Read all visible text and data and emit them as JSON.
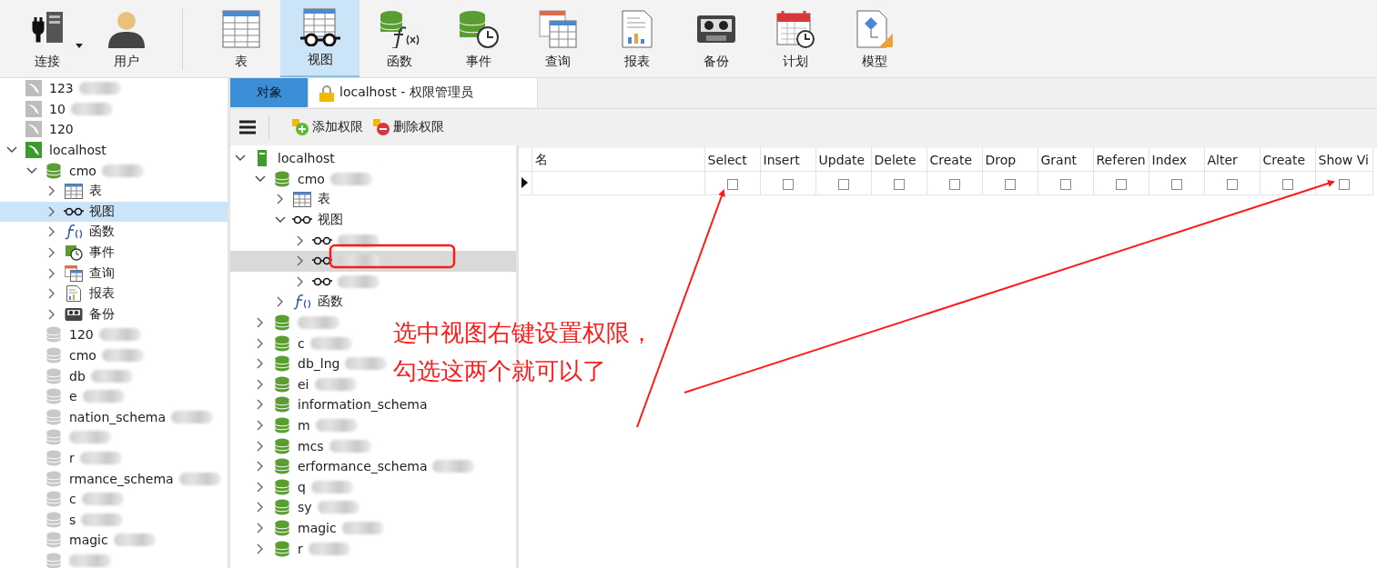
{
  "toolbar": {
    "items": [
      {
        "label": "连接",
        "kind": "connect",
        "selected": false
      },
      {
        "label": "用户",
        "kind": "user",
        "selected": false
      },
      {
        "label": "表",
        "kind": "table",
        "selected": false
      },
      {
        "label": "视图",
        "kind": "view",
        "selected": true
      },
      {
        "label": "函数",
        "kind": "function",
        "selected": false
      },
      {
        "label": "事件",
        "kind": "event",
        "selected": false
      },
      {
        "label": "查询",
        "kind": "query",
        "selected": false
      },
      {
        "label": "报表",
        "kind": "report",
        "selected": false
      },
      {
        "label": "备份",
        "kind": "backup",
        "selected": false
      },
      {
        "label": "计划",
        "kind": "schedule",
        "selected": false
      },
      {
        "label": "模型",
        "kind": "model",
        "selected": false
      }
    ]
  },
  "connection_tree": [
    {
      "label": "123",
      "kind": "connection",
      "redacted": true
    },
    {
      "label": "10",
      "kind": "connection",
      "redacted": true
    },
    {
      "label": "120",
      "kind": "connection"
    },
    {
      "label": "localhost",
      "kind": "server",
      "expanded": true,
      "children": [
        {
          "label": "cmo",
          "kind": "database",
          "expanded": true,
          "redacted": true,
          "children": [
            {
              "label": "表",
              "kind": "table",
              "expanded": false,
              "selected": false
            },
            {
              "label": "视图",
              "kind": "view",
              "expanded": false,
              "selected": true
            },
            {
              "label": "函数",
              "kind": "function",
              "expanded": false,
              "selected": false
            },
            {
              "label": "事件",
              "kind": "event",
              "expanded": false,
              "selected": false
            },
            {
              "label": "查询",
              "kind": "query",
              "expanded": false,
              "selected": false
            },
            {
              "label": "报表",
              "kind": "report",
              "expanded": false,
              "selected": false
            },
            {
              "label": "备份",
              "kind": "backup",
              "expanded": false,
              "selected": false
            }
          ]
        },
        {
          "label": "120",
          "kind": "database-off",
          "redacted": true
        },
        {
          "label": "cmo",
          "kind": "database-off",
          "redacted": true
        },
        {
          "label": "db",
          "kind": "database-off",
          "redacted": true
        },
        {
          "label": "e",
          "kind": "database-off",
          "redacted": true
        },
        {
          "label": "nation_schema",
          "kind": "database-off",
          "redacted": true
        },
        {
          "kind": "database-off",
          "redacted": true
        },
        {
          "label": "r",
          "kind": "database-off",
          "redacted": true
        },
        {
          "label": "rmance_schema",
          "kind": "database-off",
          "redacted": true
        },
        {
          "label": "c",
          "kind": "database-off",
          "redacted": true
        },
        {
          "label": "s",
          "kind": "database-off",
          "redacted": true
        },
        {
          "label": "magic",
          "kind": "database-off",
          "redacted": true
        },
        {
          "kind": "database-off",
          "redacted": true
        }
      ]
    }
  ],
  "tabs": [
    {
      "label": "对象",
      "kind": "objects",
      "selected": true
    },
    {
      "label": "localhost - 权限管理员",
      "kind": "privileges",
      "selected": false
    }
  ],
  "editor_toolbar": [
    {
      "label": "添加权限",
      "kind": "add"
    },
    {
      "label": "删除权限",
      "kind": "delete"
    }
  ],
  "privilege_tree": [
    {
      "label": "localhost",
      "kind": "server",
      "expanded": true,
      "children": [
        {
          "label": "cmo",
          "kind": "database",
          "expanded": true,
          "redacted": true,
          "children": [
            {
              "label": "表",
              "kind": "table",
              "expanded": false
            },
            {
              "label": "视图",
              "kind": "view",
              "expanded": true,
              "children": [
                {
                  "kind": "view",
                  "expanded": false,
                  "redacted": true,
                  "selected": false
                },
                {
                  "kind": "view",
                  "expanded": false,
                  "redacted": true,
                  "selected": true
                },
                {
                  "kind": "view",
                  "expanded": false,
                  "redacted": true,
                  "selected": false
                }
              ]
            },
            {
              "label": "函数",
              "kind": "function",
              "expanded": false
            }
          ]
        },
        {
          "kind": "database",
          "expanded": false,
          "redacted": true
        },
        {
          "label": "c",
          "kind": "database",
          "expanded": false,
          "redacted": true
        },
        {
          "label": "db_lng",
          "kind": "database",
          "expanded": false,
          "redacted": true
        },
        {
          "label": "ei",
          "kind": "database",
          "expanded": false,
          "redacted": true
        },
        {
          "label": "information_schema",
          "kind": "database",
          "expanded": false
        },
        {
          "label": "m",
          "kind": "database",
          "expanded": false,
          "redacted": true
        },
        {
          "label": "mcs",
          "kind": "database",
          "expanded": false,
          "redacted": true
        },
        {
          "label": "erformance_schema",
          "kind": "database",
          "expanded": false,
          "redacted": true
        },
        {
          "label": "q",
          "kind": "database",
          "expanded": false,
          "redacted": true
        },
        {
          "label": "sy",
          "kind": "database",
          "expanded": false,
          "redacted": true
        },
        {
          "label": "magic",
          "kind": "database",
          "expanded": false,
          "redacted": true
        },
        {
          "label": "r",
          "kind": "database",
          "expanded": false,
          "redacted": true
        }
      ]
    }
  ],
  "privilege_grid": {
    "columns": [
      "名",
      "Select",
      "Insert",
      "Update",
      "Delete",
      "Create",
      "Drop",
      "Grant",
      "Referen",
      "Index",
      "Alter",
      "Create",
      "Show Vi"
    ],
    "rows": [
      {
        "current": true,
        "checks": [
          false,
          false,
          false,
          false,
          false,
          false,
          false,
          false,
          false,
          false,
          false,
          false
        ]
      }
    ]
  },
  "annotation": {
    "lines": [
      "选中视图右键设置权限，",
      "勾选这两个就可以了"
    ]
  }
}
